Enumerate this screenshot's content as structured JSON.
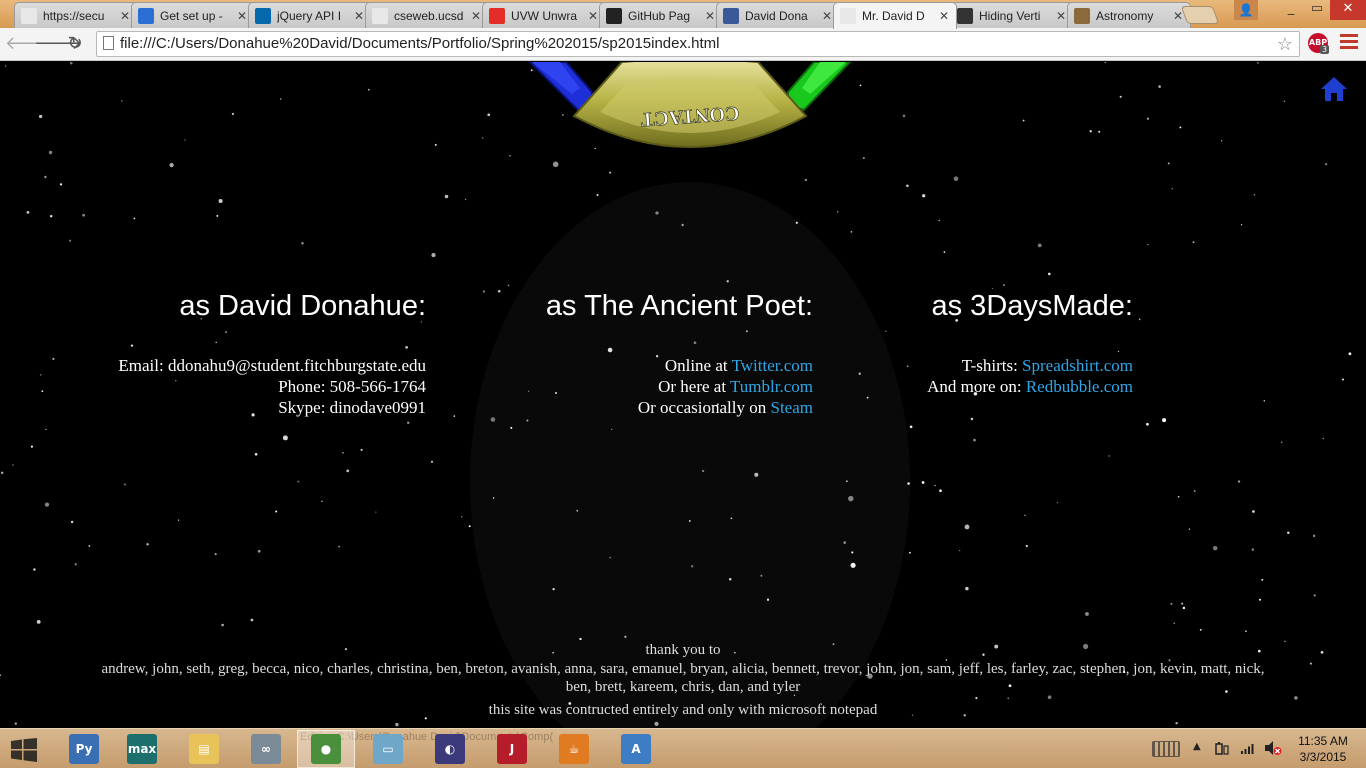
{
  "browser": {
    "tabs": [
      {
        "title": "https://secu",
        "icon": "page-icon",
        "color": "#e8e8e8"
      },
      {
        "title": "Get set up -",
        "icon": "windows-icon",
        "color": "#2b6fd6"
      },
      {
        "title": "jQuery API I",
        "icon": "jquery-icon",
        "color": "#0769ad"
      },
      {
        "title": "cseweb.ucsd",
        "icon": "page-icon",
        "color": "#e8e8e8"
      },
      {
        "title": "UVW Unwra",
        "icon": "youtube-icon",
        "color": "#e52d27"
      },
      {
        "title": "GitHub Pag",
        "icon": "github-icon",
        "color": "#222222"
      },
      {
        "title": "David Dona",
        "icon": "facebook-icon",
        "color": "#3b5998"
      },
      {
        "title": "Mr. David D",
        "icon": "page-icon",
        "color": "#e8e8e8",
        "active": true
      },
      {
        "title": "Hiding Verti",
        "icon": "m-icon",
        "color": "#333333"
      },
      {
        "title": "Astronomy",
        "icon": "astronomy-icon",
        "color": "#8a6a3a"
      }
    ],
    "address": "file:///C:/Users/Donahue%20David/Documents/Portfolio/Spring%202015/sp2015index.html",
    "abp_label": "ABP",
    "abp_count": "3",
    "win_min": "_",
    "win_max": "▭",
    "win_close": "✕"
  },
  "page": {
    "wheel_label": "CONTACT",
    "columns": [
      {
        "heading": "as David Donahue:",
        "lines": [
          {
            "prefix": "Email: ddonahu9@student.fitchburgstate.edu",
            "link": ""
          },
          {
            "prefix": "Phone: 508-566-1764",
            "link": ""
          },
          {
            "prefix": "Skype: dinodave0991",
            "link": ""
          }
        ]
      },
      {
        "heading": "as The Ancient Poet:",
        "lines": [
          {
            "prefix": "Online at ",
            "link": "Twitter.com"
          },
          {
            "prefix": "Or here at ",
            "link": "Tumblr.com"
          },
          {
            "prefix": "Or occasionally on ",
            "link": "Steam"
          }
        ]
      },
      {
        "heading": "as 3DaysMade:",
        "lines": [
          {
            "prefix": "T-shirts: ",
            "link": "Spreadshirt.com"
          },
          {
            "prefix": "And more on: ",
            "link": "Redbubble.com"
          }
        ]
      }
    ],
    "footer": {
      "thanks_title": "thank you to",
      "names": "andrew, john, seth, greg, becca, nico, charles, christina, ben, breton, avanish, anna, sara, emanuel, bryan, alicia, bennett, trevor, john, jon, sam, jeff, les, farley, zac, stephen, jon, kevin, matt, nick, ben, brett, kareem, chris, dan, and tyler",
      "built_with": "this site was contructed entirely and only with microsoft notepad"
    },
    "link_color": "#2ea6e6",
    "home_icon_color": "#1f3fd0"
  },
  "taskbar": {
    "ghost_text": "Editing C:\\Users\\Donahue David\\Documents\\Comp(",
    "items": [
      {
        "icon": "python-icon",
        "color": "#3b6fb3",
        "glyph": "Py"
      },
      {
        "icon": "3dsmax-icon",
        "color": "#1c6f6a",
        "glyph": "max"
      },
      {
        "icon": "file-explorer-icon",
        "color": "#e8c35a",
        "glyph": "▤"
      },
      {
        "icon": "network-app-icon",
        "color": "#7a8a96",
        "glyph": "∞"
      },
      {
        "icon": "chrome-icon",
        "color": "#4a8f3c",
        "glyph": "●",
        "active": true
      },
      {
        "icon": "notepad-icon",
        "color": "#6fa7c9",
        "glyph": "▭"
      },
      {
        "icon": "media-app-icon",
        "color": "#3a3a7a",
        "glyph": "◐"
      },
      {
        "icon": "j-app-icon",
        "color": "#b51d2a",
        "glyph": "J"
      },
      {
        "icon": "java-icon",
        "color": "#e07b22",
        "glyph": "☕"
      },
      {
        "icon": "document-app-icon",
        "color": "#3e7cc4",
        "glyph": "A"
      }
    ],
    "tray_up": "▲",
    "clock_time": "11:35 AM",
    "clock_date": "3/3/2015"
  }
}
